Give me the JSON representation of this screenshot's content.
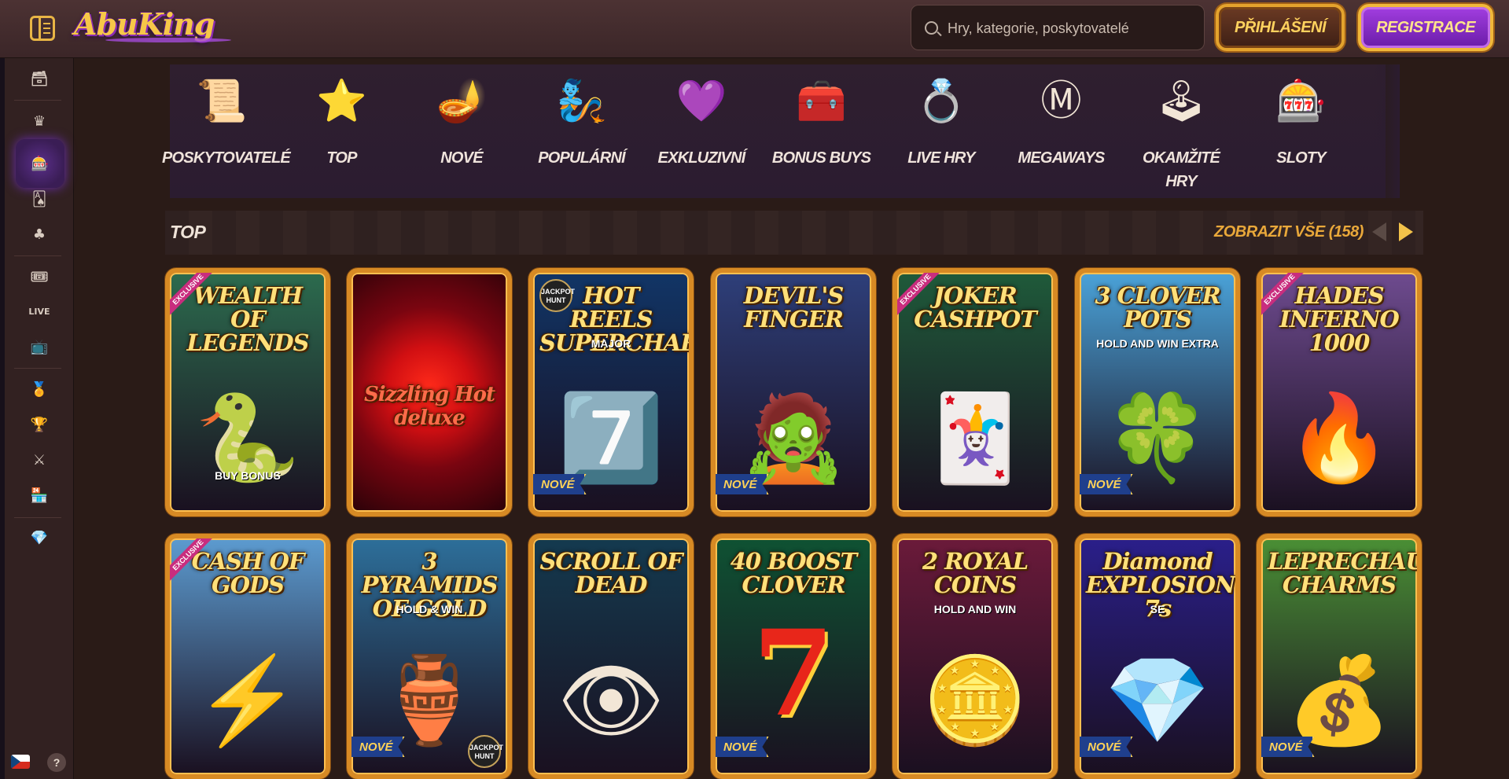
{
  "header": {
    "logo_text": "AbuKing",
    "search_placeholder": "Hry, kategorie, poskytovatelé",
    "login_label": "PŘIHLÁŠENÍ",
    "register_label": "REGISTRACE"
  },
  "sidebar": {
    "items": [
      {
        "name": "chest-icon",
        "glyph": "🗃"
      },
      {
        "name": "crown-icon",
        "glyph": "♛"
      },
      {
        "name": "slot-machine-icon",
        "glyph": "🎰",
        "active": true
      },
      {
        "name": "cards-icon",
        "glyph": "🂡"
      },
      {
        "name": "club-icon",
        "glyph": "♣"
      },
      {
        "name": "ticket-icon",
        "glyph": "🎟"
      },
      {
        "name": "live-icon",
        "glyph": "LIVE"
      },
      {
        "name": "sport-screen-icon",
        "glyph": "📺"
      },
      {
        "name": "medal-icon",
        "glyph": "🏅"
      },
      {
        "name": "trophy-icon",
        "glyph": "🏆"
      },
      {
        "name": "shield-icon",
        "glyph": "⚔"
      },
      {
        "name": "shop-icon",
        "glyph": "🏪"
      },
      {
        "name": "diamond-icon",
        "glyph": "💎"
      }
    ],
    "help_label": "?"
  },
  "categories": [
    {
      "label": "POSKYTOVATELÉ",
      "icon": "scroll-icon",
      "glyph": "📜"
    },
    {
      "label": "TOP",
      "icon": "star-icon",
      "glyph": "⭐"
    },
    {
      "label": "NOVÉ",
      "icon": "lamp-icon",
      "glyph": "🪔"
    },
    {
      "label": "POPULÁRNÍ",
      "icon": "carpet-icon",
      "glyph": "🧞"
    },
    {
      "label": "EXKLUZIVNÍ",
      "icon": "gem-icon",
      "glyph": "💜"
    },
    {
      "label": "BONUS BUYS",
      "icon": "treasure-chest-icon",
      "glyph": "🧰"
    },
    {
      "label": "LIVE HRY",
      "icon": "ring-cushion-icon",
      "glyph": "💍"
    },
    {
      "label": "MEGAWAYS",
      "icon": "megaways-m-icon",
      "glyph": "Ⓜ"
    },
    {
      "label": "OKAMŽITÉ HRY",
      "icon": "joystick-icon",
      "glyph": "🕹"
    },
    {
      "label": "SLOTY",
      "icon": "slot-reels-icon",
      "glyph": "🎰"
    }
  ],
  "section": {
    "title": "TOP",
    "view_all_label": "ZOBRAZIT VŠE (158)"
  },
  "badges": {
    "new": "NOVÉ",
    "exclusive": "EXCLUSIVE",
    "jackpot_hunt": "JACKPOT HUNT"
  },
  "games": [
    {
      "title": "WEALTH OF LEGENDS",
      "art": "🐍",
      "bg": "#2c6b4e",
      "exclusive": true,
      "extra": "BUY BONUS"
    },
    {
      "title": "Sizzling Hot deluxe",
      "art": "",
      "bg": "#8a0b12"
    },
    {
      "title": "HOT REELS SUPERCHARGED",
      "art": "7️⃣",
      "bg": "#113566",
      "new": true,
      "jackpot": true,
      "extra": "MAJOR"
    },
    {
      "title": "DEVIL'S FINGER",
      "art": "🧟",
      "bg": "#2e3f7a",
      "new": true
    },
    {
      "title": "JOKER CASHPOT",
      "art": "🃏",
      "bg": "#1f5a3a",
      "exclusive": true
    },
    {
      "title": "3 CLOVER POTS",
      "art": "🍀",
      "bg": "#4aa2d8",
      "new": true,
      "extra": "HOLD AND WIN EXTRA"
    },
    {
      "title": "HADES INFERNO 1000",
      "art": "🔥",
      "bg": "#6e4b8f",
      "exclusive": true
    },
    {
      "title": "CASH OF GODS",
      "art": "⚡",
      "bg": "#5c9bd0",
      "exclusive": true
    },
    {
      "title": "3 PYRAMIDS OF GOLD",
      "art": "🏺",
      "bg": "#2d6f9a",
      "new": true,
      "jackpot": true,
      "extra": "HOLD & WIN"
    },
    {
      "title": "SCROLL OF DEAD",
      "art": "👁",
      "bg": "#143a4f"
    },
    {
      "title": "40 BOOST CLOVER",
      "art": "7",
      "bg": "#0f5233",
      "new": true
    },
    {
      "title": "2 ROYAL COINS",
      "art": "🪙",
      "bg": "#6b1a3a",
      "extra": "HOLD AND WIN"
    },
    {
      "title": "Diamond EXPLOSION 7s",
      "art": "💎",
      "bg": "#2a1f8a",
      "new": true,
      "extra": "SE"
    },
    {
      "title": "LEPRECHAUN CHARMS",
      "art": "💰",
      "bg": "#4a8f35",
      "new": true
    }
  ],
  "colors": {
    "accent_gold": "#e8b545",
    "register_purple": "#8a2bd0",
    "view_all_orange": "#e9a83a"
  }
}
